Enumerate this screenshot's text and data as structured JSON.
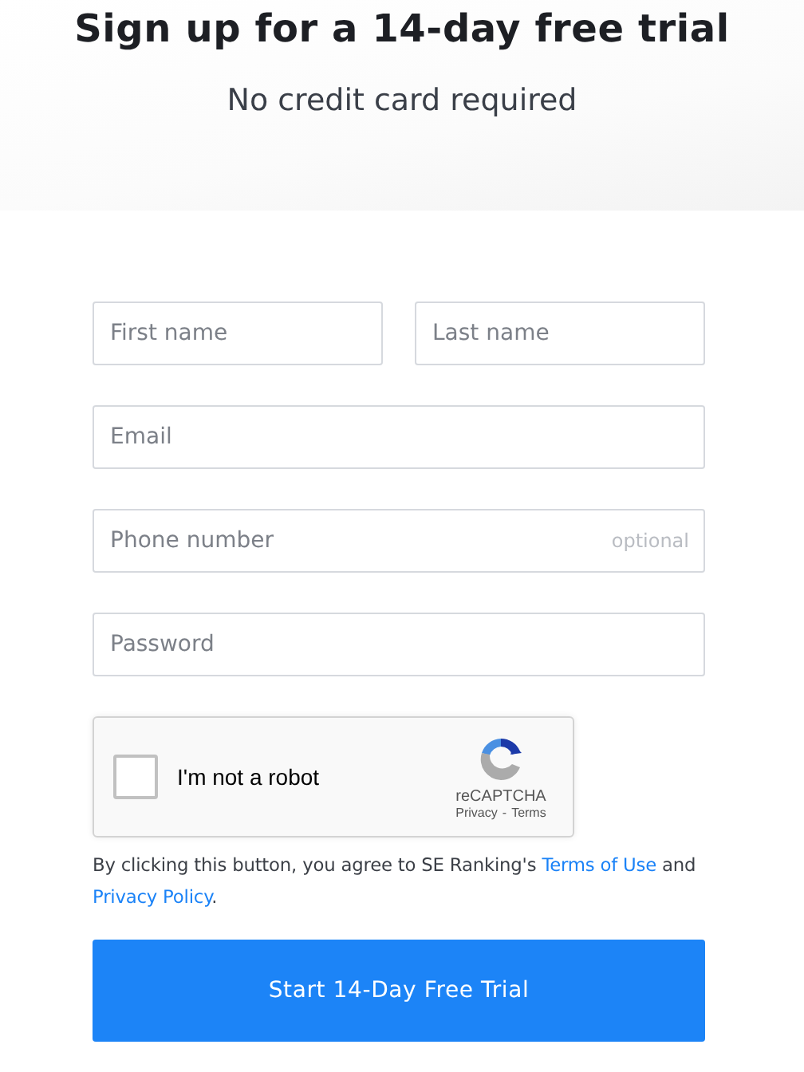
{
  "header": {
    "title": "Sign up for a 14-day free trial",
    "subtitle": "No credit card required"
  },
  "fields": [
    {
      "placeholder": "First name"
    },
    {
      "placeholder": "Last name"
    },
    {
      "placeholder": "Email"
    },
    {
      "placeholder": "Phone number",
      "hint": "optional"
    },
    {
      "placeholder": "Password"
    }
  ],
  "captcha": {
    "label": "I'm not a robot",
    "checked": false,
    "brand": "reCAPTCHA",
    "privacy": "Privacy",
    "separator": "-",
    "terms": "Terms"
  },
  "consent": [
    {
      "kind": "text",
      "text": "By clicking this button, you agree to SE Ranking's "
    },
    {
      "kind": "link",
      "text": "Terms of Use"
    },
    {
      "kind": "text",
      "text": " and "
    },
    {
      "kind": "link",
      "text": "Privacy Policy"
    },
    {
      "kind": "text",
      "text": "."
    }
  ],
  "submit": {
    "label": "Start 14-Day Free Trial"
  }
}
